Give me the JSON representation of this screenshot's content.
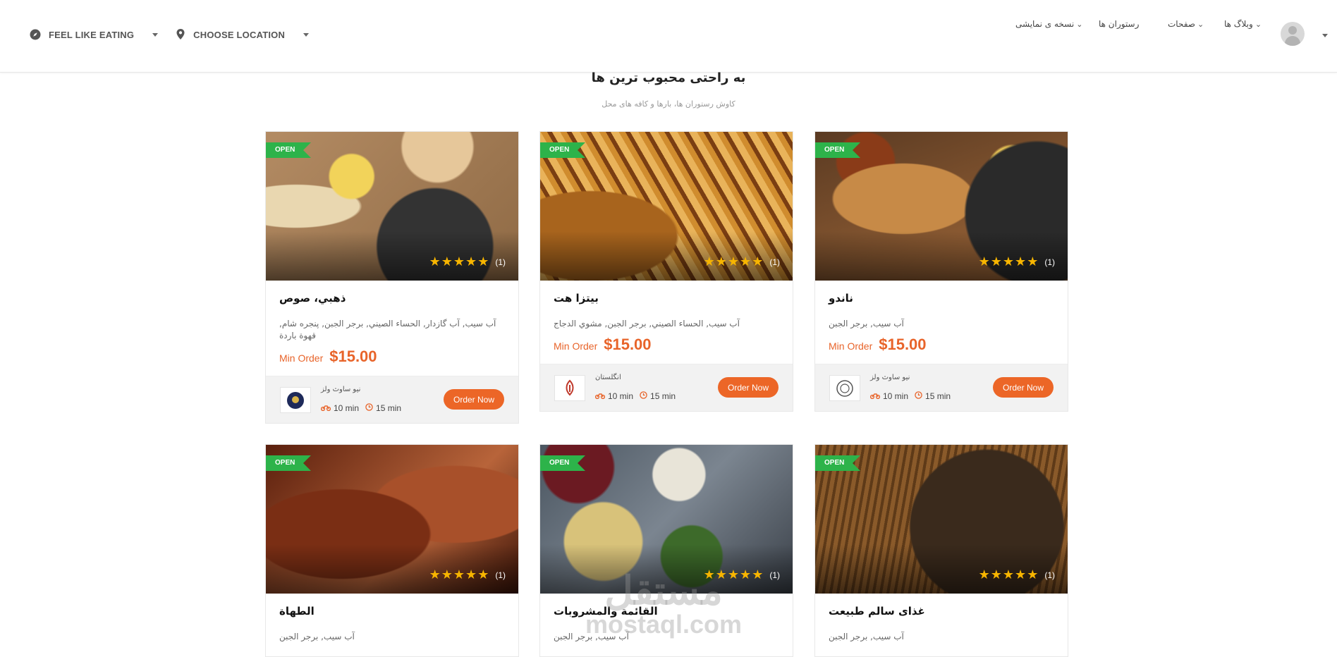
{
  "header": {
    "feel_like_eating": "FEEL LIKE EATING",
    "choose_location": "CHOOSE LOCATION",
    "nav": [
      {
        "label": "نسخه ی نمایشی"
      },
      {
        "label": "رستوران ها"
      },
      {
        "label": "صفحات"
      },
      {
        "label": "وبلاگ ها"
      }
    ]
  },
  "section": {
    "title": "به راحتی محبوب ترین ها",
    "subtitle": "کاوش رستوران ها، بارها و کافه های محل"
  },
  "cards": [
    {
      "badge": "OPEN",
      "rating_count": "(1)",
      "stars": 5,
      "name": "ذهبي، صوص",
      "cuisines": "آب سيب, آب گازدار, الحساء الصيني, برجر الجبن, پنجره شام, قهوة باردة",
      "min_order_label": "Min Order",
      "min_order": "$15.00",
      "shop": "نيو ساوث ولز",
      "delivery_time": "10 min",
      "prep_time": "15 min",
      "button": "Order Now",
      "photo": "food-plate-sauces"
    },
    {
      "badge": "OPEN",
      "rating_count": "(1)",
      "stars": 5,
      "name": "بيتزا هت",
      "cuisines": "آب سيب, الحساء الصيني, برجر الجبن, مشوي الدجاج",
      "min_order_label": "Min Order",
      "min_order": "$15.00",
      "shop": "انگلستان",
      "delivery_time": "10 min",
      "prep_time": "15 min",
      "button": "Order Now",
      "photo": "fried-chicken-fries"
    },
    {
      "badge": "OPEN",
      "rating_count": "(1)",
      "stars": 5,
      "name": "ناندو",
      "cuisines": "آب سيب, برجر الجبن",
      "min_order_label": "Min Order",
      "min_order": "$15.00",
      "shop": "نيو ساوث ولز",
      "delivery_time": "10 min",
      "prep_time": "15 min",
      "button": "Order Now",
      "photo": "seafood-paella"
    },
    {
      "badge": "OPEN",
      "rating_count": "(1)",
      "stars": 5,
      "name": "الطهاة",
      "cuisines": "آب سيب, برجر الجبن",
      "photo": "grilled-meat"
    },
    {
      "badge": "OPEN",
      "rating_count": "(1)",
      "stars": 5,
      "name": "القائمة والمشروبات",
      "cuisines": "آب سيب, برجر الجبن",
      "photo": "drinks-glasses"
    },
    {
      "badge": "OPEN",
      "rating_count": "(1)",
      "stars": 5,
      "name": "غذای سالم طبیعت",
      "cuisines": "آب سيب, برجر الجبن",
      "photo": "noodle-pan"
    }
  ],
  "watermark": {
    "arabic": "مستقل",
    "latin": "mostaql.com"
  },
  "colors": {
    "accent": "#ec6627",
    "open_badge": "#2db34a",
    "star": "#f7b500"
  }
}
